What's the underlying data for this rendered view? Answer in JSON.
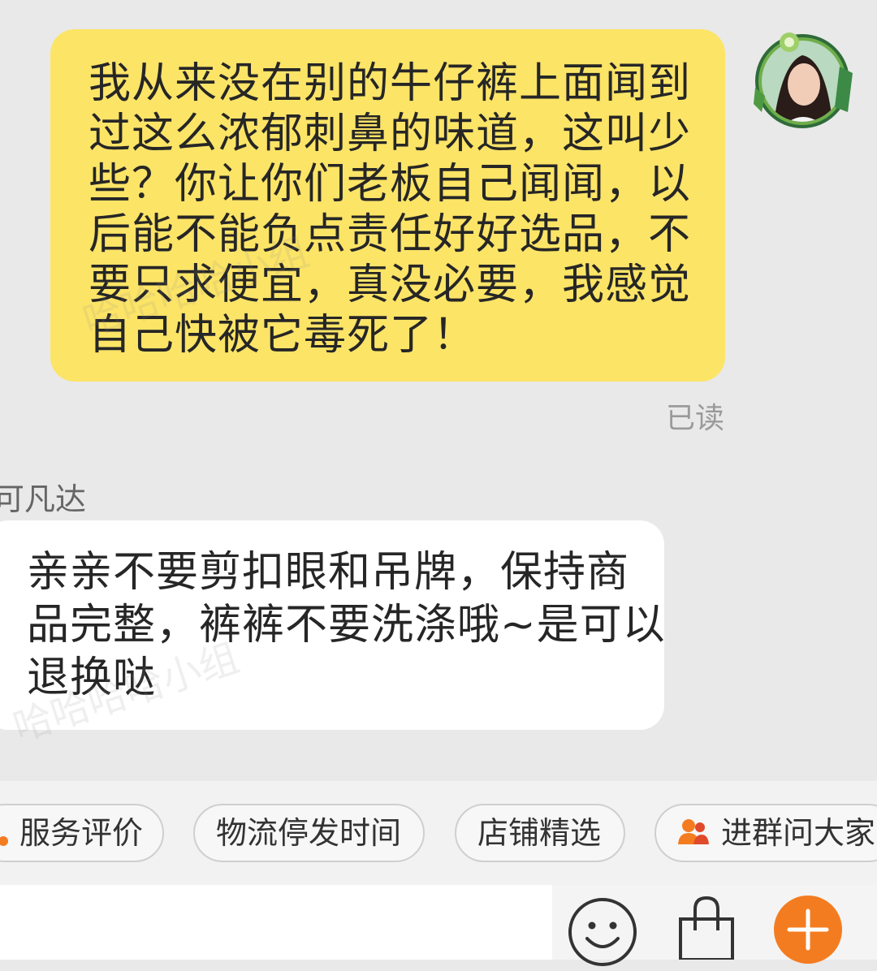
{
  "messages": {
    "sent": {
      "lines": [
        "我从来没在别的牛仔裤上面闻到",
        "过这么浓郁刺鼻的味道，这叫少",
        "些？你让你们老板自己闻闻，以",
        "后能不能负点责任好好选品，不",
        "要只求便宜，真没必要，我感觉",
        "自己快被它毒死了！"
      ],
      "status": "已读"
    },
    "received": {
      "sender": "可凡达",
      "lines": [
        "亲亲不要剪扣眼和吊牌，保持商",
        "品完整，裤裤不要洗涤哦~是可以",
        "退换哒"
      ]
    }
  },
  "watermark": "哈哈哈哈小组",
  "quick_replies": [
    {
      "label": "服务评价",
      "icon": "dot-icon"
    },
    {
      "label": "物流停发时间"
    },
    {
      "label": "店铺精选"
    },
    {
      "label": "进群问大家",
      "icon": "group-icon"
    }
  ],
  "colors": {
    "sent_bubble": "#fce467",
    "received_bubble": "#ffffff",
    "background": "#e9e9e9",
    "accent": "#f47c20"
  },
  "input": {
    "placeholder": ""
  },
  "toolbar_icons": [
    "emoji-icon",
    "shopping-bag-icon",
    "plus-icon"
  ]
}
